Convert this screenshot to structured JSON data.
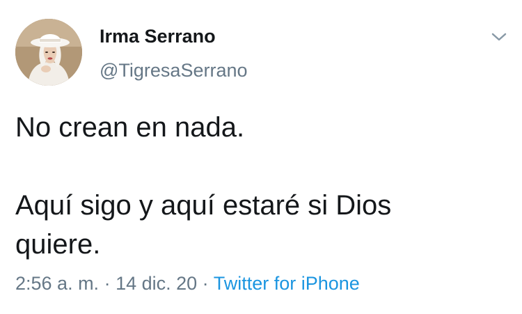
{
  "tweet": {
    "author": {
      "display_name": "Irma Serrano",
      "handle": "@TigresaSerrano",
      "avatar_icon": "profile-photo"
    },
    "menu_icon": "chevron-down-icon",
    "text_lines": [
      "No crean en nada.",
      "",
      "Aquí sigo y aquí estaré si Dios",
      "quiere."
    ],
    "time": "2:56 a. m.",
    "separator_1": " · ",
    "date": "14 dic. 20",
    "separator_2": " · ",
    "source": "Twitter for iPhone"
  },
  "colors": {
    "text": "#14171a",
    "secondary": "#657786",
    "link": "#1b95e0"
  }
}
